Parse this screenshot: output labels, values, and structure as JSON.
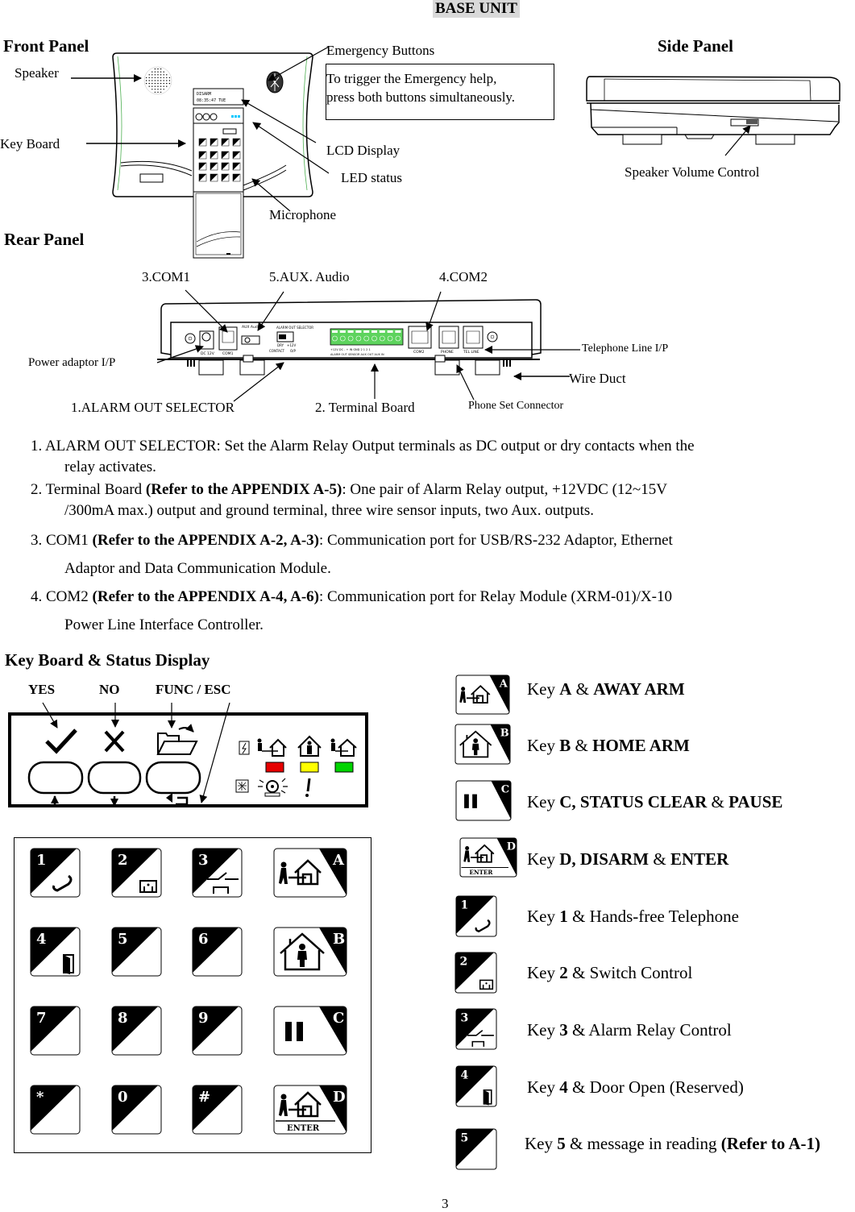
{
  "page_title": "BASE UNIT",
  "front_panel": {
    "heading": "Front Panel",
    "labels": {
      "speaker": "Speaker",
      "key_board": "Key Board",
      "emergency_buttons": "Emergency Buttons",
      "lcd_display": "LCD Display",
      "led_status": "LED status",
      "microphone": "Microphone"
    },
    "note_lines": [
      "To trigger the Emergency help,",
      "press both buttons simultaneously."
    ],
    "lcd_line1": "DISARM",
    "lcd_line2": "08:35:47  TUE"
  },
  "side_panel": {
    "heading": "Side Panel",
    "labels": {
      "speaker_volume": "Speaker Volume Control"
    }
  },
  "rear_panel": {
    "heading": "Rear Panel",
    "labels": {
      "com1": "3.COM1",
      "aux_audio": "5.AUX. Audio",
      "com2": "4.COM2",
      "telephone_line": "Telephone Line I/P",
      "power_adaptor": "Power adaptor I/P",
      "wire_duct": "Wire Duct",
      "alarm_out_selector": "1.ALARM OUT SELECTOR",
      "terminal_board": "2. Terminal Board",
      "phone_set": "Phone Set Connector"
    },
    "port_labels": {
      "dc": "DC 12V",
      "com1": "COM1",
      "aux": "AUX Audio",
      "sel_title": "ALARM OUT SELECTOR",
      "dry": "DRY",
      "contact": "CONTACT",
      "v12": "+12V",
      "op": "O/P",
      "term": "+12V DC  -  +  IN  GND  2  1  2  1",
      "term2": "ALARM OUT  SENSOR  AUX OUT  AUX IN",
      "com2": "COM2",
      "phone": "PHONE",
      "telline": "TEL LINE"
    }
  },
  "descriptions": [
    {
      "prefix": "1. ALARM OUT SELECTOR: Set the Alarm Relay Output terminals as DC output or dry contacts when the",
      "bold": "",
      "rest": "",
      "cont": "relay activates."
    },
    {
      "prefix": "2. Terminal Board ",
      "bold": "(Refer to the APPENDIX A-5)",
      "rest": ": One pair of Alarm Relay output, +12VDC (12~15V",
      "cont": "/300mA max.) output and ground terminal, three wire sensor inputs, two Aux. outputs."
    },
    {
      "prefix": "3. COM1 ",
      "bold": "(Refer to the APPENDIX A-2, A-3)",
      "rest": ": Communication port for USB/RS-232 Adaptor, Ethernet",
      "cont": "Adaptor and Data Communication Module."
    },
    {
      "prefix": "4. COM2 ",
      "bold": "(Refer to the APPENDIX A-4, A-6)",
      "rest": ": Communication port for Relay Module (XRM-01)/X-10",
      "cont": "Power Line Interface Controller."
    }
  ],
  "keyboard_section": {
    "heading": "Key Board & Status Display",
    "top_labels": {
      "yes": "YES",
      "no": "NO",
      "func": "FUNC / ESC"
    },
    "led_colors": {
      "red": "#e60000",
      "yellow": "#ffff00",
      "green": "#00d400"
    },
    "keys": [
      {
        "num": "1",
        "icon": "phone"
      },
      {
        "num": "2",
        "icon": "switch"
      },
      {
        "num": "3",
        "icon": "relay"
      },
      {
        "letter": "A",
        "icon": "away-arm"
      },
      {
        "num": "4",
        "icon": "door"
      },
      {
        "num": "5",
        "icon": ""
      },
      {
        "num": "6",
        "icon": ""
      },
      {
        "letter": "B",
        "icon": "home-arm"
      },
      {
        "num": "7",
        "icon": ""
      },
      {
        "num": "8",
        "icon": ""
      },
      {
        "num": "9",
        "icon": ""
      },
      {
        "letter": "C",
        "icon": "pause"
      },
      {
        "num": "*",
        "icon": ""
      },
      {
        "num": "0",
        "icon": ""
      },
      {
        "num": "#",
        "icon": ""
      },
      {
        "letter": "D",
        "icon": "disarm",
        "sub": "ENTER"
      }
    ],
    "legend": [
      {
        "pre": "Key ",
        "b1": "A",
        "mid": " & ",
        "b2": "AWAY ARM",
        "post": ""
      },
      {
        "pre": "Key ",
        "b1": "B",
        "mid": " & ",
        "b2": "HOME ARM",
        "post": ""
      },
      {
        "pre": "Key ",
        "b1": "C, STATUS CLEAR",
        "mid": " & ",
        "b2": "PAUSE",
        "post": ""
      },
      {
        "pre": "Key ",
        "b1": "D, DISARM",
        "mid": " & ",
        "b2": "ENTER",
        "post": ""
      },
      {
        "pre": "Key ",
        "b1": "1",
        "mid": " & Hands-free Telephone",
        "b2": "",
        "post": ""
      },
      {
        "pre": "Key ",
        "b1": "2",
        "mid": " & Switch Control",
        "b2": "",
        "post": ""
      },
      {
        "pre": "Key ",
        "b1": "3",
        "mid": " & Alarm Relay Control",
        "b2": "",
        "post": ""
      },
      {
        "pre": "Key ",
        "b1": "4",
        "mid": " & Door Open (Reserved)",
        "b2": "",
        "post": ""
      },
      {
        "pre": "Key ",
        "b1": "5",
        "mid": " & message in reading ",
        "b2": "(Refer to A-1)",
        "post": ""
      }
    ],
    "enter_label": "ENTER"
  },
  "page_number": "3"
}
